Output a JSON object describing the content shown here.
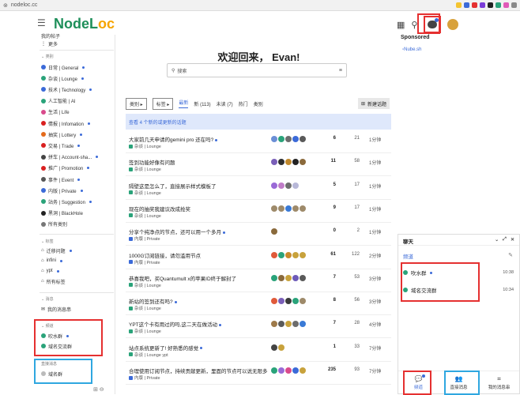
{
  "browser": {
    "url": "nodeloc.cc"
  },
  "header": {
    "logo_main": "NodeL",
    "logo_accent": "oc"
  },
  "sidebar": {
    "top_items": [
      {
        "label": "我的帖子"
      },
      {
        "label": "更多"
      }
    ],
    "categories_heading": "类别",
    "categories": [
      {
        "label": "日常 | General",
        "color": "#3b6ad8",
        "new": true
      },
      {
        "label": "杂谈 | Lounge",
        "color": "#2aa37a",
        "new": true
      },
      {
        "label": "技术 | Technology",
        "color": "#3b6ad8",
        "new": true
      },
      {
        "label": "人工智能 | AI",
        "color": "#2aa37a",
        "new": false
      },
      {
        "label": "生活 | Life",
        "color": "#d94a8c",
        "new": false
      },
      {
        "label": "情报 | Infomation",
        "color": "#d92020",
        "new": true
      },
      {
        "label": "抽奖 | Lottery",
        "color": "#e46a1b",
        "new": true
      },
      {
        "label": "交易 | Trade",
        "color": "#d92020",
        "new": true
      },
      {
        "label": "拼车 | Account-sha...",
        "color": "#444444",
        "new": true
      },
      {
        "label": "推广 | Promotion",
        "color": "#d92020",
        "new": true
      },
      {
        "label": "事件 | Event",
        "color": "#555555",
        "new": true
      },
      {
        "label": "内版 | Private",
        "color": "#3b6ad8",
        "new": true
      },
      {
        "label": "站务 | Suggestion",
        "color": "#2aa37a",
        "new": true
      },
      {
        "label": "黑洞 | BlackHole",
        "color": "#222222",
        "new": false
      },
      {
        "label": "所有类别",
        "color": "#777777",
        "new": false
      }
    ],
    "tags_heading": "标签",
    "tags": [
      {
        "label": "迁移问题",
        "new": true
      },
      {
        "label": "infini",
        "new": true
      },
      {
        "label": "ypt",
        "new": true
      },
      {
        "label": "所有标签",
        "new": false
      }
    ],
    "messages_heading": "消息",
    "messages_item": "我的消息串",
    "channels_heading": "频道",
    "channels": [
      {
        "label": "吹水群",
        "new": true
      },
      {
        "label": "域名交流群",
        "new": false
      }
    ],
    "direct_heading": "直接消息",
    "direct": [
      {
        "label": "域名群"
      }
    ]
  },
  "main": {
    "welcome": "欢迎回来，  Evan!",
    "search_placeholder": "搜索",
    "nav": {
      "categories_drop": "类别",
      "tags_drop": "标签",
      "tabs": [
        "最新",
        "新 (113)",
        "未读 (7)",
        "热门",
        "类别"
      ],
      "new_topic": "新建话题"
    },
    "notice": "查看 4 个新的或更新的话题",
    "topics": [
      {
        "title": "大家前几天申请的gemini pro 还在吗?",
        "new": true,
        "category": "杂谈 | Lounge",
        "cat_color": "#2aa37a",
        "replies": "6",
        "views": "21",
        "activity": "1分钟",
        "avatars": [
          "#6b8fd6",
          "#2aa37a",
          "#6d6d6d",
          "#3b6ad8",
          "#5a5a5a"
        ]
      },
      {
        "title": "签到功能好像有问题",
        "new": false,
        "category": "杂谈 | Lounge",
        "cat_color": "#2aa37a",
        "replies": "11",
        "views": "58",
        "activity": "1分钟",
        "avatars": [
          "#7a5fb8",
          "#2e2e2e",
          "#c0882c",
          "#222222",
          "#8b6a3c"
        ]
      },
      {
        "title": "隔壁这是怎么了，直接展示样式模板了",
        "new": false,
        "category": "杂谈 | Lounge",
        "cat_color": "#2aa37a",
        "replies": "5",
        "views": "17",
        "activity": "1分钟",
        "avatars": [
          "#9a6ad6",
          "#c07cc8",
          "#6d6d6d",
          "#b8b8d8"
        ]
      },
      {
        "title": "现在的抽奖我建议改成抢奖",
        "new": false,
        "category": "杂谈 | Lounge",
        "cat_color": "#2aa37a",
        "replies": "9",
        "views": "17",
        "activity": "1分钟",
        "avatars": [
          "#9e8a6a",
          "#9e8a6a",
          "#3a7ad6",
          "#9e8a6a",
          "#9e8a6a"
        ]
      },
      {
        "title": "分享个纯净点的节点，还可以用一个多月",
        "new": true,
        "category": "内版 | Private",
        "cat_color": "#3b6ad8",
        "replies": "0",
        "views": "2",
        "activity": "1分钟",
        "avatars": [
          "#8a6a3c"
        ]
      },
      {
        "title": "1000G订阅链接，请勿滥用节点",
        "new": false,
        "category": "内版 | Private",
        "cat_color": "#3b6ad8",
        "replies": "61",
        "views": "122",
        "activity": "2分钟",
        "avatars": [
          "#e05a3a",
          "#2aa37a",
          "#c88a2c",
          "#c8a23c",
          "#c8a23c"
        ]
      },
      {
        "title": "恭喜我吧，买Quantumult x的苹果ID终于解封了",
        "new": false,
        "category": "杂谈 | Lounge",
        "cat_color": "#2aa37a",
        "replies": "7",
        "views": "53",
        "activity": "3分钟",
        "avatars": [
          "#2aa37a",
          "#8a6a3c",
          "#c8a23c",
          "#6d5ab8",
          "#5a5a5a"
        ]
      },
      {
        "title": "新站的签到还有吗?",
        "new": true,
        "category": "杂谈 | Lounge",
        "cat_color": "#2aa37a",
        "replies": "8",
        "views": "56",
        "activity": "3分钟",
        "avatars": [
          "#e05a3a",
          "#7a5fb8",
          "#3a3a3a",
          "#2aa37a",
          "#9e8a6a"
        ]
      },
      {
        "title": "YPT这个卡有用过的吗,这二天在做活动",
        "new": true,
        "category": "杂谈 | Lounge",
        "cat_color": "#2aa37a",
        "replies": "7",
        "views": "28",
        "activity": "4分钟",
        "avatars": [
          "#9e7a4a",
          "#5a5a5a",
          "#c8a23c",
          "#6d6d6d",
          "#3a7ad6"
        ]
      },
      {
        "title": "站点系统更新了! 好熟悉的感觉",
        "new": true,
        "category": "杂谈 | Lounge  ypt",
        "cat_color": "#2aa37a",
        "replies": "1",
        "views": "33",
        "activity": "7分钟",
        "avatars": [
          "#444444",
          "#c8a23c"
        ]
      },
      {
        "title": "合理使用订阅节点，持续贡献更新，里面的节点可以说无限多",
        "new": false,
        "category": "内版 | Private",
        "cat_color": "#3b6ad8",
        "replies": "235",
        "views": "93",
        "activity": "7分钟",
        "avatars": [
          "#2aa37a",
          "#9a6ad6",
          "#d94a8c",
          "#3b6ad8",
          "#c8a23c"
        ]
      }
    ]
  },
  "sponsored": {
    "heading": "Sponsored",
    "link": "Nube.sh"
  },
  "chat": {
    "title": "聊天",
    "channels_label": "频道",
    "channels": [
      {
        "name": "吹水群",
        "time": "10:38",
        "new": true
      },
      {
        "name": "域名交流群",
        "time": "10:34",
        "new": false
      }
    ],
    "tabs": [
      {
        "label": "频道",
        "icon": "chat-bubbles-icon",
        "active": true
      },
      {
        "label": "直接消息",
        "icon": "users-icon",
        "active": false
      },
      {
        "label": "我的消息串",
        "icon": "threads-icon",
        "active": false
      }
    ]
  },
  "colors": {
    "accent": "#3b6ad8",
    "highlight_red": "#e53030",
    "highlight_blue": "#2fa7e0",
    "brand_green": "#1e8f5a",
    "brand_orange": "#f6a400"
  }
}
